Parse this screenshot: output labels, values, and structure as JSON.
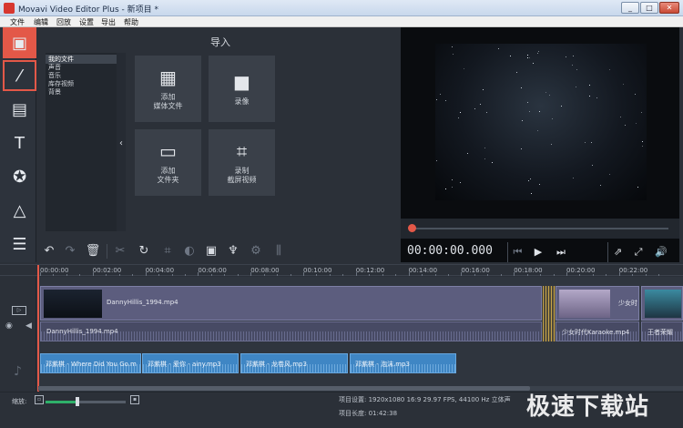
{
  "window": {
    "title": "Movavi Video Editor Plus - 新项目 *",
    "min_glyph": "_",
    "max_glyph": "□",
    "close_glyph": "✕"
  },
  "menu": [
    "文件",
    "编辑",
    "回放",
    "设置",
    "导出",
    "帮助"
  ],
  "tools": [
    {
      "icon": "film-import-icon",
      "glyph": "▣"
    },
    {
      "icon": "magic-wand-icon",
      "glyph": "⁄"
    },
    {
      "icon": "transitions-icon",
      "glyph": "▤"
    },
    {
      "icon": "titles-icon",
      "glyph": "T"
    },
    {
      "icon": "stickers-star-icon",
      "glyph": "✪"
    },
    {
      "icon": "shapes-icon",
      "glyph": "△"
    },
    {
      "icon": "menu-list-icon",
      "glyph": "☰"
    }
  ],
  "library": {
    "items": [
      "我的文件",
      "声音",
      "音乐",
      "库存视频",
      "背景"
    ],
    "selected_index": 0,
    "collapse_glyph": "‹"
  },
  "import": {
    "title": "导入",
    "buttons": [
      {
        "label": "添加\n媒体文件",
        "icon": "add-media-icon",
        "glyph": "▦"
      },
      {
        "label": "录像",
        "icon": "camcorder-icon",
        "glyph": "■"
      },
      {
        "label": "添加\n文件夹",
        "icon": "folder-icon",
        "glyph": "▭"
      },
      {
        "label": "录制\n截屏视频",
        "icon": "screen-capture-icon",
        "glyph": "⌗"
      }
    ]
  },
  "edit_toolbar": [
    {
      "name": "undo-icon",
      "glyph": "↶",
      "enabled": true
    },
    {
      "name": "redo-icon",
      "glyph": "↷",
      "enabled": false
    },
    {
      "name": "delete-icon",
      "glyph": "🗑",
      "enabled": true
    },
    {
      "name": "cut-icon",
      "glyph": "✂",
      "enabled": false
    },
    {
      "name": "rotate-icon",
      "glyph": "↻",
      "enabled": true
    },
    {
      "name": "crop-icon",
      "glyph": "⌗",
      "enabled": false
    },
    {
      "name": "color-adjust-icon",
      "glyph": "◐",
      "enabled": false
    },
    {
      "name": "picture-icon",
      "glyph": "▣",
      "enabled": true
    },
    {
      "name": "microphone-icon",
      "glyph": "♆",
      "enabled": true
    },
    {
      "name": "settings-gear-icon",
      "glyph": "⚙",
      "enabled": false
    },
    {
      "name": "equalizer-icon",
      "glyph": "⫼",
      "enabled": false
    }
  ],
  "transport": {
    "timecode": "00:00:00.000",
    "buttons": [
      {
        "name": "prev-frame-icon",
        "glyph": "⏮",
        "enabled": false
      },
      {
        "name": "play-icon",
        "glyph": "▶",
        "enabled": true
      },
      {
        "name": "next-frame-icon",
        "glyph": "⏭",
        "enabled": true
      },
      {
        "name": "export-icon",
        "glyph": "⇗",
        "enabled": true
      },
      {
        "name": "fullscreen-icon",
        "glyph": "⤢",
        "enabled": true
      },
      {
        "name": "volume-icon",
        "glyph": "🔊",
        "enabled": true
      }
    ],
    "progress": 0
  },
  "ruler": [
    "00:00:00",
    "00:02:00",
    "00:04:00",
    "00:06:00",
    "00:08:00",
    "00:10:00",
    "00:12:00",
    "00:14:00",
    "00:16:00",
    "00:18:00",
    "00:20:00",
    "00:22:00"
  ],
  "tracks": {
    "video": [
      {
        "name": "DannyHillis_1994.mp4"
      },
      {
        "name": "少女时"
      }
    ],
    "audio": [
      {
        "name": "DannyHillis_1994.mp4"
      },
      {
        "name": "少女时代Karaoke.mp4"
      },
      {
        "name": "王者荣耀"
      }
    ],
    "music": [
      {
        "name": "邓紫棋 - Where Did You Go.m"
      },
      {
        "name": "邓紫棋 - 爱你 - ainy.mp3"
      },
      {
        "name": "邓紫棋 - 龙卷风.mp3"
      },
      {
        "name": "邓紫棋 - 泡沫.mp3"
      }
    ]
  },
  "status": {
    "zoom_label": "缩放:",
    "zoom_level": 0.4,
    "project_settings": "项目设置: 1920x1080 16:9 29.97 FPS, 44100 Hz 立体声",
    "project_length": "项目长度: 01:42:38"
  },
  "watermark": "极速下载站"
}
